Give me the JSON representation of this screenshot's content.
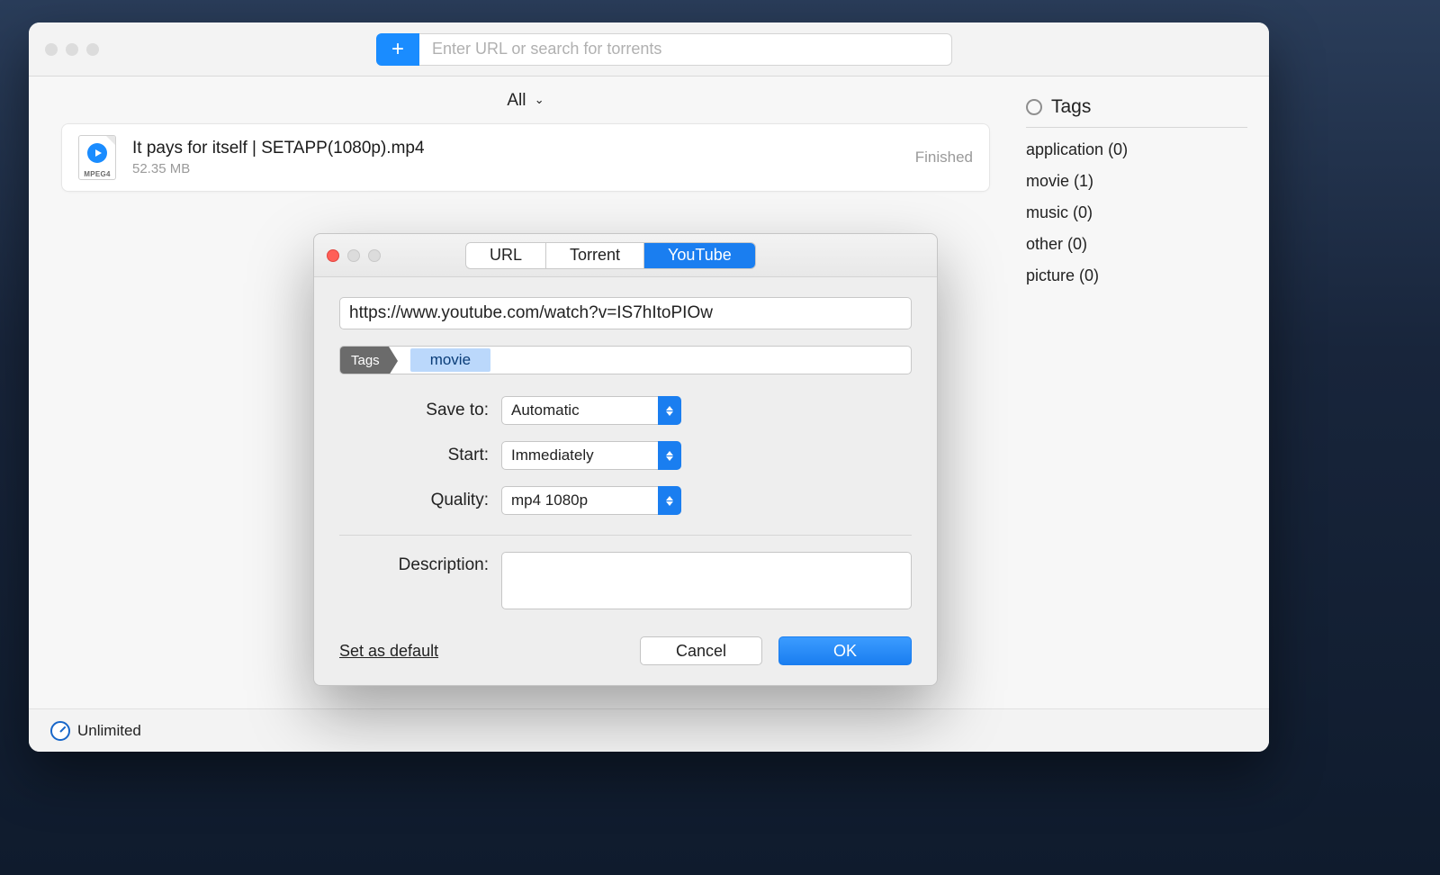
{
  "header": {
    "search_placeholder": "Enter URL or search for torrents"
  },
  "filter": {
    "label": "All"
  },
  "download": {
    "file_ext": "MPEG4",
    "title": "It pays for itself | SETAPP(1080p).mp4",
    "size": "52.35 MB",
    "status": "Finished"
  },
  "sidebar": {
    "heading": "Tags",
    "tags": [
      "application (0)",
      "movie (1)",
      "music (0)",
      "other (0)",
      "picture (0)"
    ]
  },
  "footer": {
    "speed": "Unlimited"
  },
  "modal": {
    "tabs": {
      "url": "URL",
      "torrent": "Torrent",
      "youtube": "YouTube"
    },
    "url_value": "https://www.youtube.com/watch?v=IS7hItoPIOw",
    "tags_label": "Tags",
    "tag_chip": "movie",
    "labels": {
      "save_to": "Save to:",
      "start": "Start:",
      "quality": "Quality:",
      "description": "Description:"
    },
    "values": {
      "save_to": "Automatic",
      "start": "Immediately",
      "quality": "mp4 1080p"
    },
    "set_default": "Set as default",
    "cancel": "Cancel",
    "ok": "OK"
  }
}
